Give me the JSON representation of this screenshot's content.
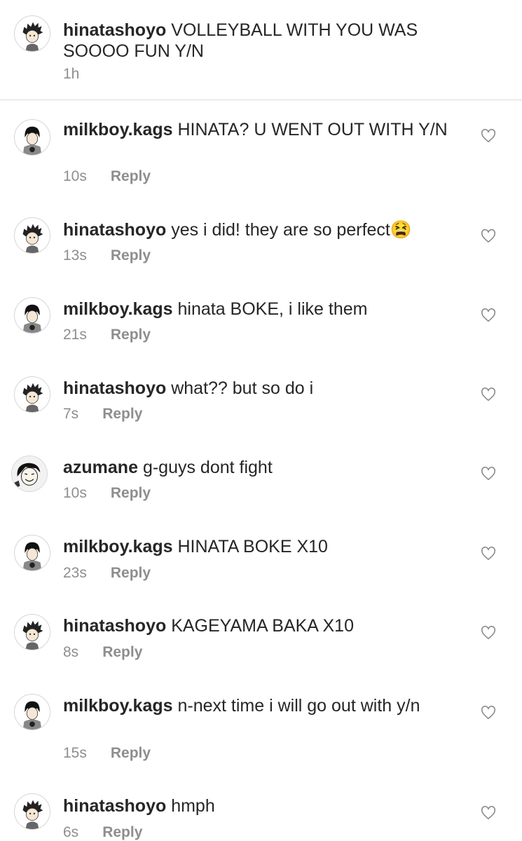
{
  "caption": {
    "username": "hinatashoyo",
    "text": "VOLLEYBALL WITH YOU WAS SOOOO FUN Y/N",
    "time": "1h"
  },
  "reply_label": "Reply",
  "comments": [
    {
      "username": "milkboy.kags",
      "text": "HINATA? U WENT OUT WITH Y/N",
      "time": "10s"
    },
    {
      "username": "hinatashoyo",
      "text": "yes i did! they are so perfect😫",
      "time": "13s"
    },
    {
      "username": "milkboy.kags",
      "text": "hinata BOKE, i like them",
      "time": "21s"
    },
    {
      "username": "hinatashoyo",
      "text": "what?? but so do i",
      "time": "7s"
    },
    {
      "username": "azumane",
      "text": "g-guys dont fight",
      "time": "10s"
    },
    {
      "username": "milkboy.kags",
      "text": "HINATA BOKE X10",
      "time": "23s"
    },
    {
      "username": "hinatashoyo",
      "text": "KAGEYAMA BAKA X10",
      "time": "8s"
    },
    {
      "username": "milkboy.kags",
      "text": "n-next time i will go out with y/n",
      "time": "15s"
    },
    {
      "username": "hinatashoyo",
      "text": "hmph",
      "time": "6s"
    }
  ],
  "icons": {
    "heart": "heart-outline-icon",
    "avatar_hinata": "hinata-avatar",
    "avatar_kageyama": "kageyama-avatar",
    "avatar_azumane": "azumane-avatar"
  },
  "colors": {
    "text": "#262626",
    "secondary": "#8e8e8e",
    "divider": "#dbdbdb"
  }
}
